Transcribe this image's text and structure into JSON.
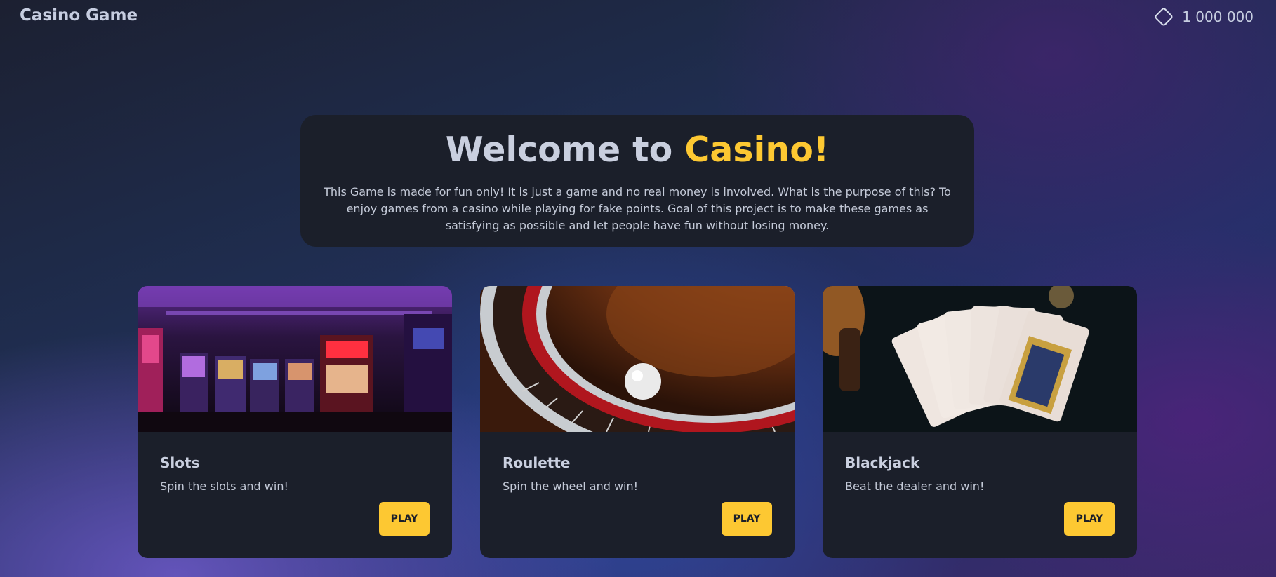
{
  "header": {
    "brand": "Casino Game",
    "balance": "1 000 000",
    "balance_icon": "diamond-icon"
  },
  "welcome": {
    "title_prefix": "Welcome to ",
    "title_accent": "Casino!",
    "text": "This Game is made for fun only! It is just a game and no real money is involved. What is the purpose of this? To enjoy games from a casino while playing for fake points. Goal of this project is to make these games as satisfying as possible and let people have fun without losing money."
  },
  "games": [
    {
      "title": "Slots",
      "description": "Spin the slots and win!",
      "button": "PLAY",
      "image": "slot-machines-photo"
    },
    {
      "title": "Roulette",
      "description": "Spin the wheel and win!",
      "button": "PLAY",
      "image": "roulette-wheel-photo"
    },
    {
      "title": "Blackjack",
      "description": "Beat the dealer and win!",
      "button": "PLAY",
      "image": "playing-cards-photo"
    }
  ],
  "colors": {
    "accent": "#fdc832",
    "card_bg": "#1b1f2a",
    "text": "#c9cfdf"
  }
}
